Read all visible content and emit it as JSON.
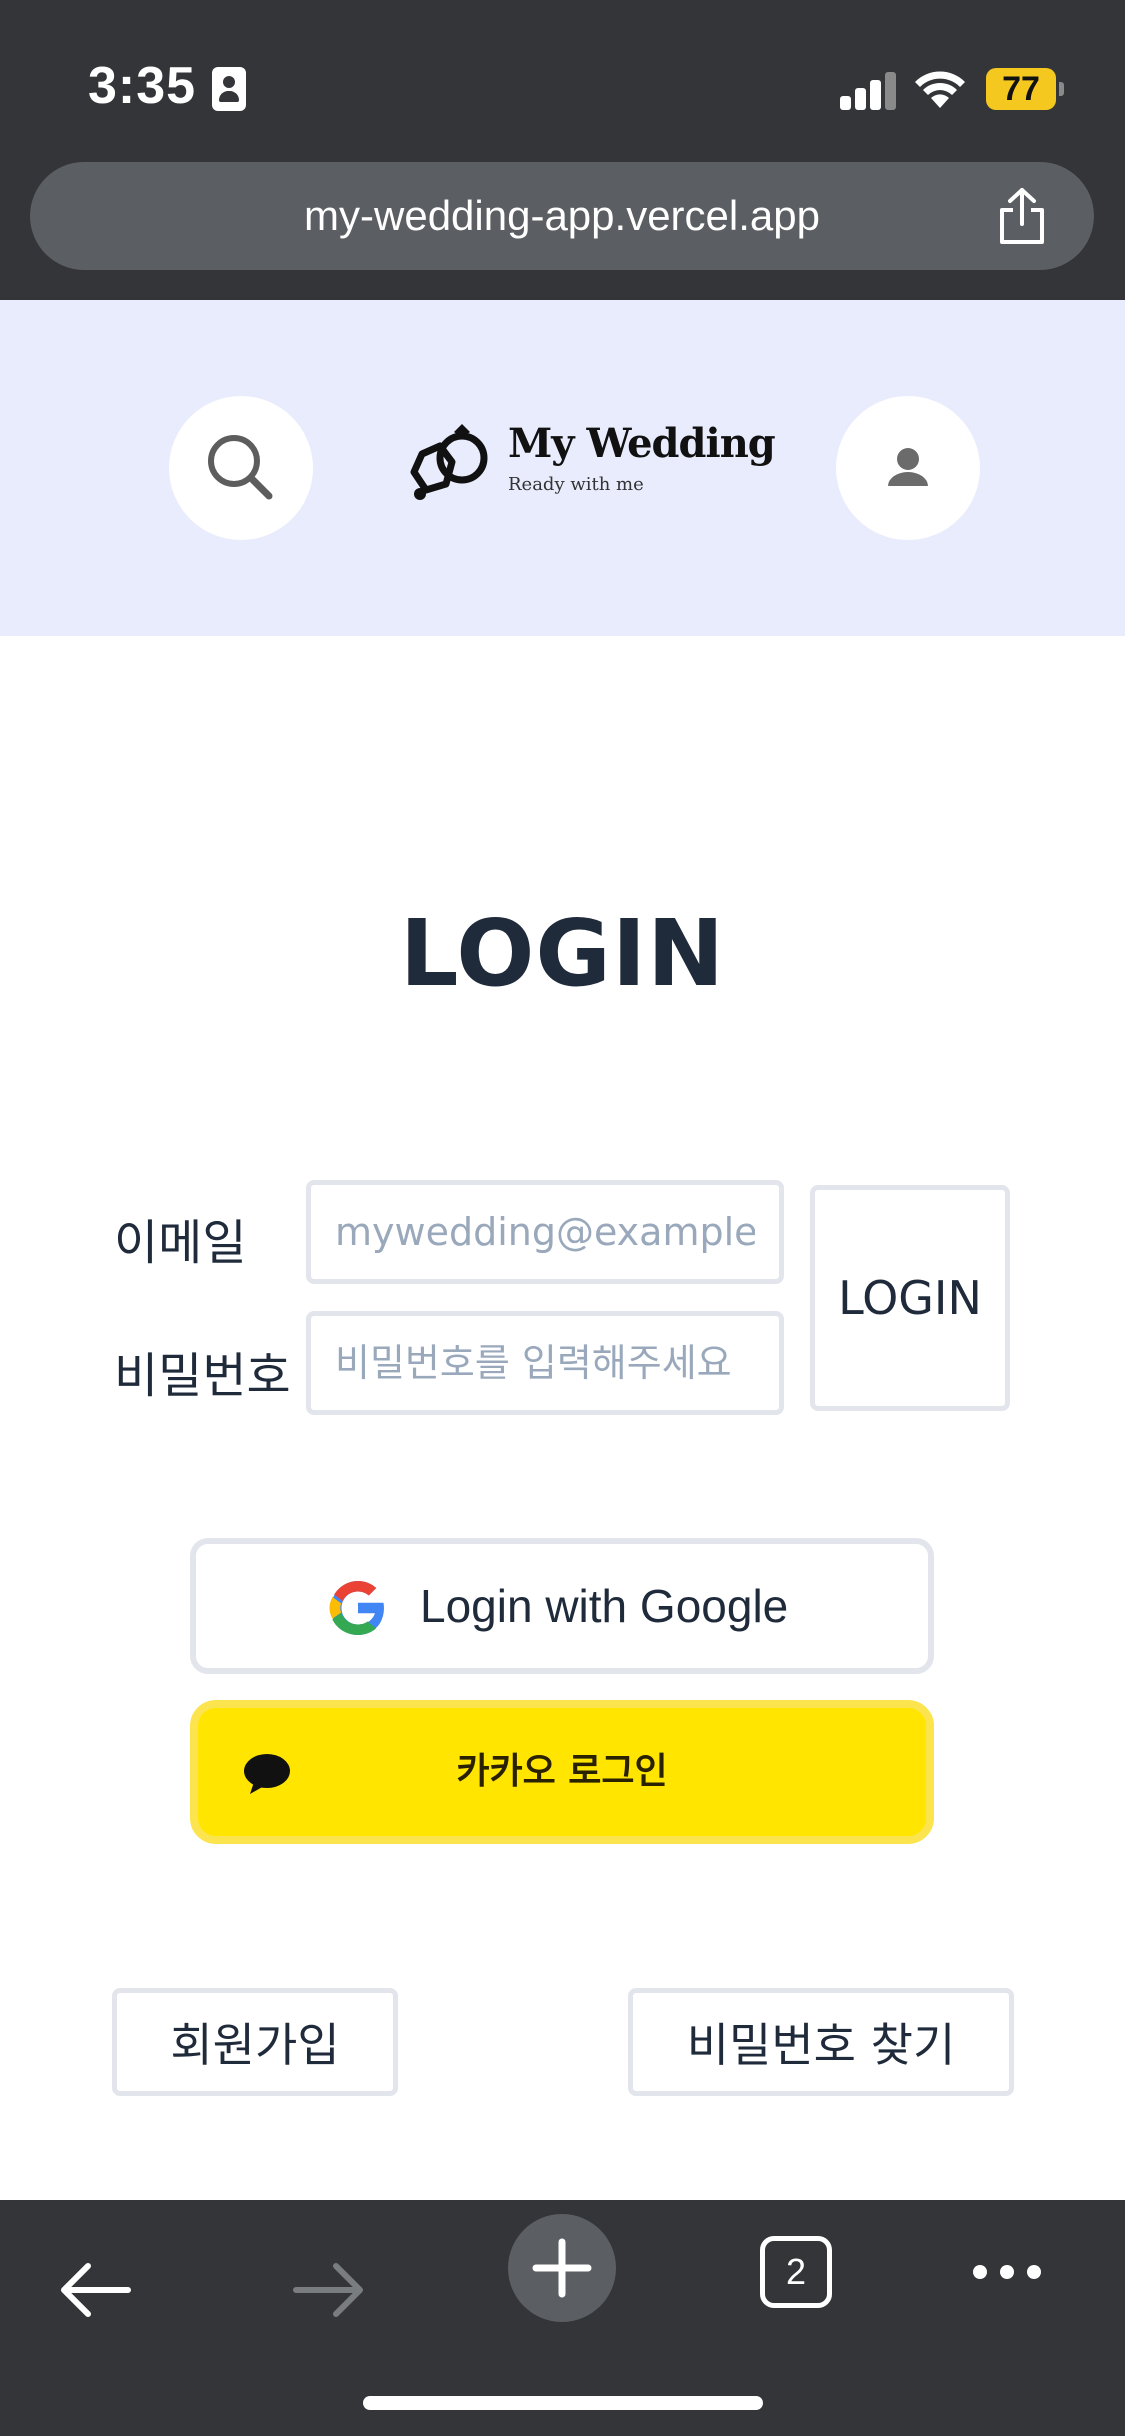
{
  "status_bar": {
    "time": "3:35",
    "battery": "77"
  },
  "browser": {
    "url": "my-wedding-app.vercel.app",
    "tab_count": "2"
  },
  "header": {
    "logo_title": "My Wedding",
    "logo_subtitle": "Ready with me"
  },
  "login": {
    "title": "LOGIN",
    "email_label": "이메일",
    "email_placeholder": "mywedding@example.com",
    "password_label": "비밀번호",
    "password_placeholder": "비밀번호를 입력해주세요",
    "submit_label": "LOGIN"
  },
  "social": {
    "google_label": "Login with Google",
    "kakao_label": "카카오 로그인"
  },
  "footer": {
    "signup_label": "회원가입",
    "find_password_label": "비밀번호 찾기"
  },
  "colors": {
    "header_bg": "#e9ecfc",
    "kakao_yellow": "#ffe500",
    "text_dark": "#1f2a3a",
    "browser_chrome": "#333538"
  }
}
